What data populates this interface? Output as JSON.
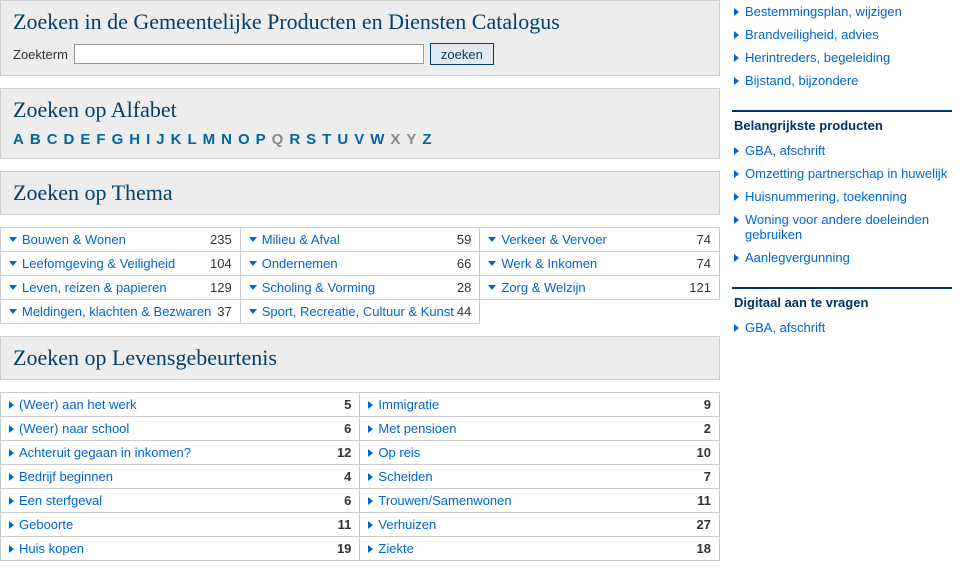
{
  "search": {
    "title": "Zoeken in de Gemeentelijke Producten en Diensten Catalogus",
    "label": "Zoekterm",
    "button": "zoeken"
  },
  "alphabet": {
    "title": "Zoeken op Alfabet",
    "letters": [
      {
        "ch": "A",
        "enabled": true
      },
      {
        "ch": "B",
        "enabled": true
      },
      {
        "ch": "C",
        "enabled": true
      },
      {
        "ch": "D",
        "enabled": true
      },
      {
        "ch": "E",
        "enabled": true
      },
      {
        "ch": "F",
        "enabled": true
      },
      {
        "ch": "G",
        "enabled": true
      },
      {
        "ch": "H",
        "enabled": true
      },
      {
        "ch": "I",
        "enabled": true
      },
      {
        "ch": "J",
        "enabled": true
      },
      {
        "ch": "K",
        "enabled": true
      },
      {
        "ch": "L",
        "enabled": true
      },
      {
        "ch": "M",
        "enabled": true
      },
      {
        "ch": "N",
        "enabled": true
      },
      {
        "ch": "O",
        "enabled": true
      },
      {
        "ch": "P",
        "enabled": true
      },
      {
        "ch": "Q",
        "enabled": false
      },
      {
        "ch": "R",
        "enabled": true
      },
      {
        "ch": "S",
        "enabled": true
      },
      {
        "ch": "T",
        "enabled": true
      },
      {
        "ch": "U",
        "enabled": true
      },
      {
        "ch": "V",
        "enabled": true
      },
      {
        "ch": "W",
        "enabled": true
      },
      {
        "ch": "X",
        "enabled": false
      },
      {
        "ch": "Y",
        "enabled": false
      },
      {
        "ch": "Z",
        "enabled": true
      }
    ]
  },
  "themes": {
    "title": "Zoeken op Thema",
    "columns": [
      [
        {
          "label": "Bouwen & Wonen",
          "count": 235
        },
        {
          "label": "Leefomgeving & Veiligheid",
          "count": 104
        },
        {
          "label": "Leven, reizen & papieren",
          "count": 129
        },
        {
          "label": "Meldingen, klachten & Bezwaren",
          "count": 37
        }
      ],
      [
        {
          "label": "Milieu & Afval",
          "count": 59
        },
        {
          "label": "Ondernemen",
          "count": 66
        },
        {
          "label": "Scholing & Vorming",
          "count": 28
        },
        {
          "label": "Sport, Recreatie, Cultuur & Kunst",
          "count": 44
        }
      ],
      [
        {
          "label": "Verkeer & Vervoer",
          "count": 74
        },
        {
          "label": "Werk & Inkomen",
          "count": 74
        },
        {
          "label": "Zorg & Welzijn",
          "count": 121
        }
      ]
    ]
  },
  "life": {
    "title": "Zoeken op Levensgebeurtenis",
    "columns": [
      [
        {
          "label": "(Weer) aan het werk",
          "count": 5
        },
        {
          "label": "(Weer) naar school",
          "count": 6
        },
        {
          "label": "Achteruit gegaan in inkomen?",
          "count": 12
        },
        {
          "label": "Bedrijf beginnen",
          "count": 4
        },
        {
          "label": "Een sterfgeval",
          "count": 6
        },
        {
          "label": "Geboorte",
          "count": 11
        },
        {
          "label": "Huis kopen",
          "count": 19
        }
      ],
      [
        {
          "label": "Immigratie",
          "count": 9
        },
        {
          "label": "Met pensioen",
          "count": 2
        },
        {
          "label": "Op reis",
          "count": 10
        },
        {
          "label": "Scheiden",
          "count": 7
        },
        {
          "label": "Trouwen/Samenwonen",
          "count": 11
        },
        {
          "label": "Verhuizen",
          "count": 27
        },
        {
          "label": "Ziekte",
          "count": 18
        }
      ]
    ]
  },
  "sidebar": {
    "sections": [
      {
        "title": "",
        "items": [
          "Bestemmingsplan, wijzigen",
          "Brandveiligheid, advies",
          "Herintreders, begeleiding",
          "Bijstand, bijzondere"
        ]
      },
      {
        "title": "Belangrijkste producten",
        "items": [
          "GBA, afschrift",
          "Omzetting partnerschap in huwelijk",
          "Huisnummering, toekenning",
          "Woning voor andere doeleinden gebruiken",
          "Aanlegvergunning"
        ]
      },
      {
        "title": "Digitaal aan te vragen",
        "items": [
          "GBA, afschrift"
        ]
      }
    ]
  }
}
